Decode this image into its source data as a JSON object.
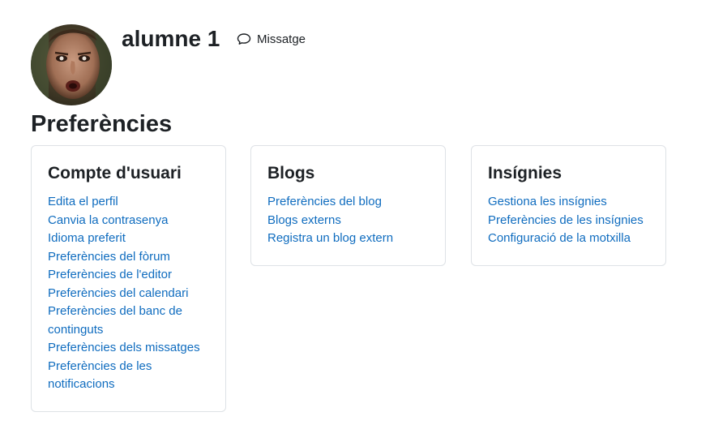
{
  "profile": {
    "name": "alumne 1",
    "message_label": "Missatge"
  },
  "page": {
    "title": "Preferències"
  },
  "sections": [
    {
      "title": "Compte d'usuari",
      "links": [
        "Edita el perfil",
        "Canvia la contrasenya",
        "Idioma preferit",
        "Preferències del fòrum",
        "Preferències de l'editor",
        "Preferències del calendari",
        "Preferències del banc de continguts",
        "Preferències dels missatges",
        "Preferències de les notificacions"
      ]
    },
    {
      "title": "Blogs",
      "links": [
        "Preferències del blog",
        "Blogs externs",
        "Registra un blog extern"
      ]
    },
    {
      "title": "Insígnies",
      "links": [
        "Gestiona les insígnies",
        "Preferències de les insígnies",
        "Configuració de la motxilla"
      ]
    }
  ],
  "colors": {
    "link": "#0f6cbf",
    "text": "#1d2125",
    "card_border": "#dee2e6"
  },
  "icons": {
    "message": "speech-bubble-icon",
    "avatar": "user-photo"
  }
}
